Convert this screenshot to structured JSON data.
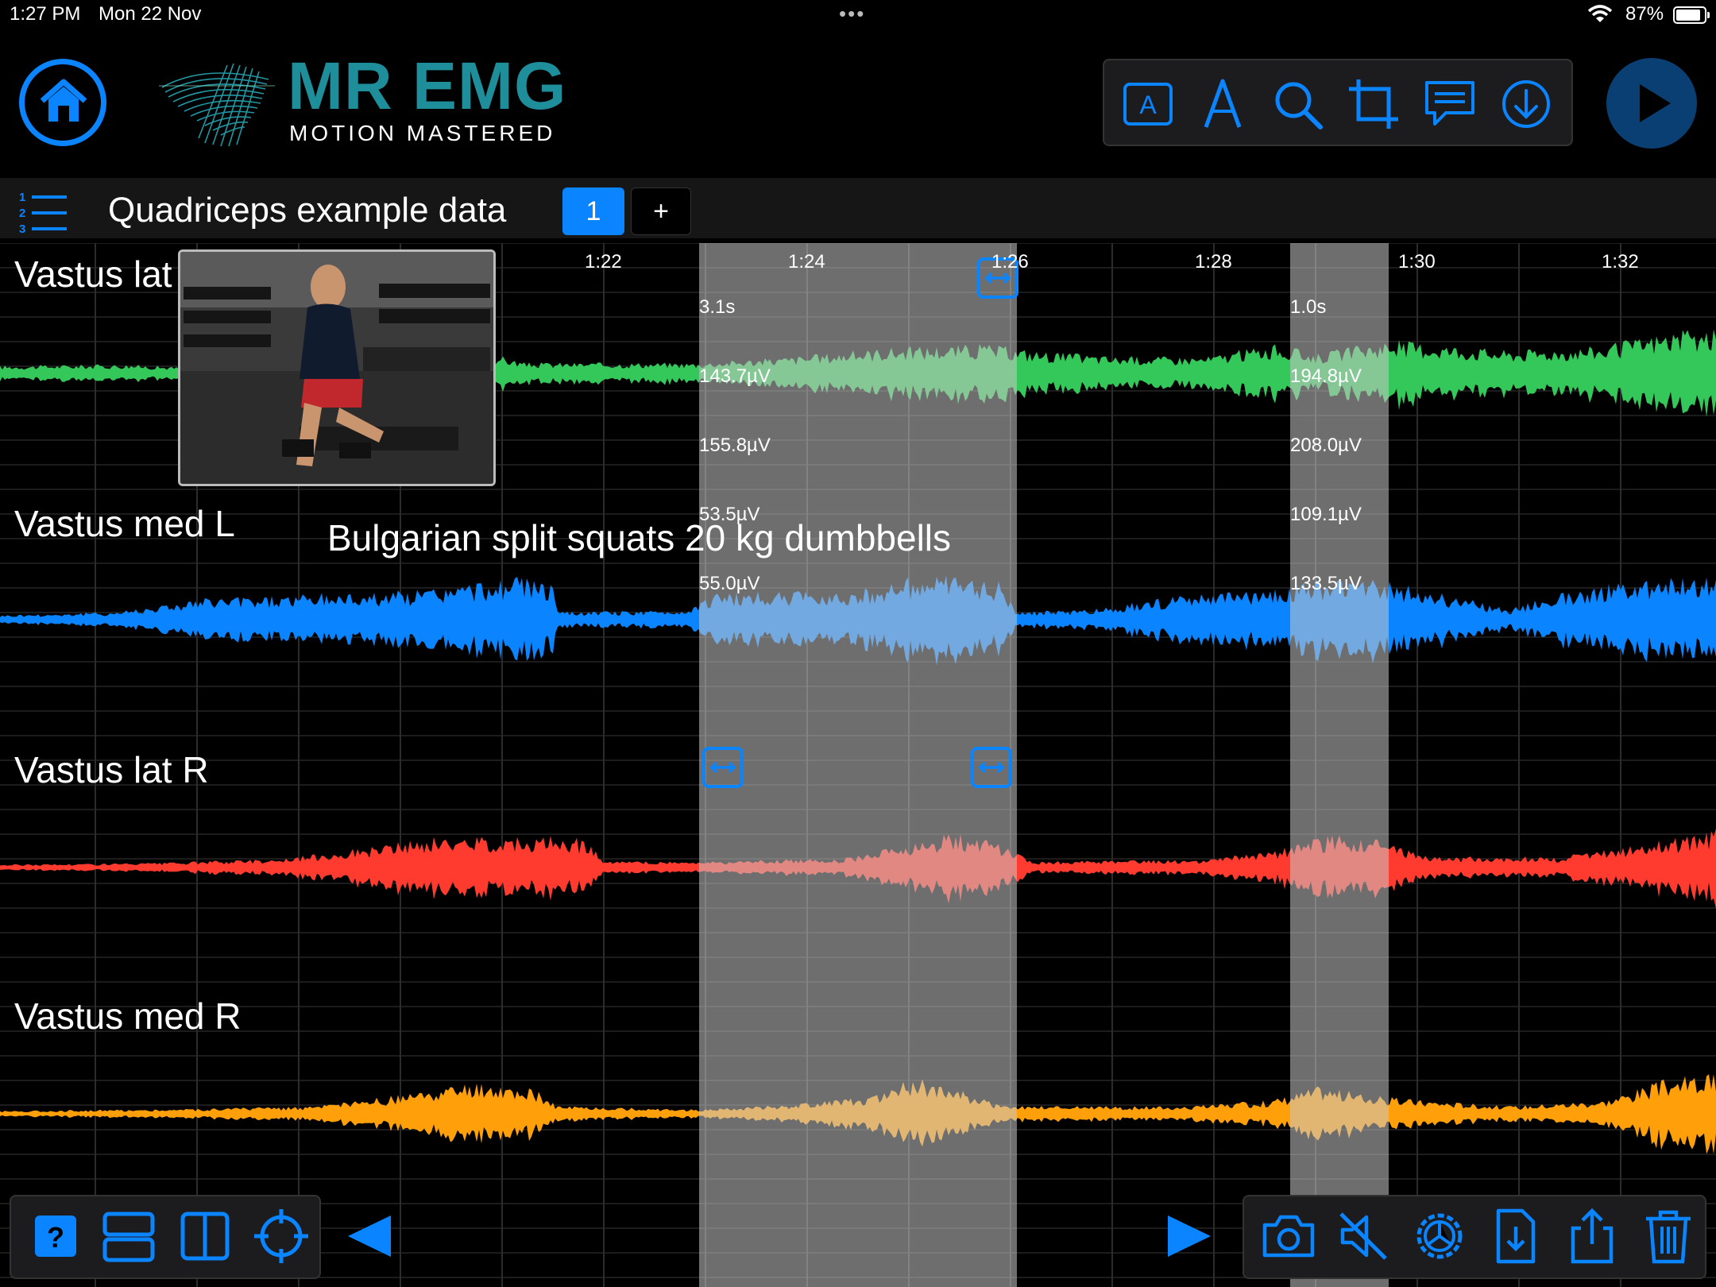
{
  "status_bar": {
    "time": "1:27 PM",
    "date": "Mon 22 Nov",
    "battery": "87%"
  },
  "header": {
    "logo_title": "MR EMG",
    "logo_tagline": "MOTION MASTERED",
    "tools": [
      "text-box-icon",
      "pen-icon",
      "search-icon",
      "crop-icon",
      "comment-icon",
      "download-icon"
    ]
  },
  "file_bar": {
    "title": "Quadriceps example data",
    "tab_label": "1",
    "add_label": "+"
  },
  "plot": {
    "time_ticks": [
      "1:22",
      "1:24",
      "1:26",
      "1:28",
      "1:30",
      "1:32"
    ],
    "annotation": "Bulgarian split squats 20 kg dumbbells",
    "channels": [
      {
        "name": "Vastus lat L",
        "color": "#34c759"
      },
      {
        "name": "Vastus med L",
        "color": "#0a84ff"
      },
      {
        "name": "Vastus lat R",
        "color": "#ff3b30"
      },
      {
        "name": "Vastus med R",
        "color": "#ff9f0a"
      }
    ],
    "selections": [
      {
        "duration": "3.1s",
        "values": [
          "143.7µV",
          "155.8µV",
          "53.5µV",
          "55.0µV"
        ]
      },
      {
        "duration": "1.0s",
        "values": [
          "194.8µV",
          "208.0µV",
          "109.1µV",
          "133.5µV"
        ]
      }
    ]
  },
  "bottom_toolbar": {
    "left": [
      "help-icon",
      "stacked-layout-icon",
      "split-layout-icon",
      "crosshair-icon"
    ],
    "right": [
      "camera-icon",
      "mute-icon",
      "settings-icon",
      "import-file-icon",
      "share-icon",
      "trash-icon"
    ]
  }
}
